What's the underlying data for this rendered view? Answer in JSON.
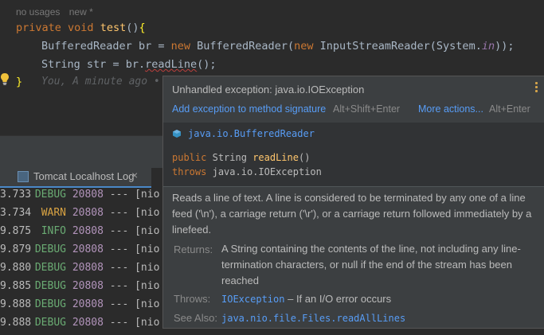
{
  "editor": {
    "meta": {
      "usages": "no usages",
      "new": "new *"
    },
    "lines": {
      "l1": {
        "kw1": "private",
        "kw2": "void",
        "name": "test",
        "parens": "()",
        "brace": "{"
      },
      "l2": {
        "type": "BufferedReader",
        "var": "br",
        "eq": "=",
        "kw": "new",
        "ctor": "BufferedReader",
        "p1": "(",
        "kw2": "new",
        "ctor2": "InputStreamReader",
        "p2": "(System.",
        "field": "in",
        "end": "));"
      },
      "l3": {
        "type": "String",
        "var": "str",
        "eq": "=",
        "call": "br.",
        "method": "readLine",
        "end": "();"
      },
      "l4": {
        "brace": "}"
      }
    },
    "inlay_hint": "You, A minute ago •"
  },
  "tool_tab": {
    "label": "Tomcat Localhost Log",
    "close": "×"
  },
  "console": {
    "rows": [
      {
        "time": "3.733",
        "level": "DEBUG",
        "level_class": "debug",
        "pid": "20808",
        "rest": "--- [nio"
      },
      {
        "time": "3.734",
        "level": "WARN",
        "level_class": "warn",
        "pid": "20808",
        "rest": "--- [nio"
      },
      {
        "time": "9.875",
        "level": "INFO",
        "level_class": "info",
        "pid": "20808",
        "rest": "--- [nio"
      },
      {
        "time": "9.879",
        "level": "DEBUG",
        "level_class": "debug",
        "pid": "20808",
        "rest": "--- [nio"
      },
      {
        "time": "9.880",
        "level": "DEBUG",
        "level_class": "debug",
        "pid": "20808",
        "rest": "--- [nio"
      },
      {
        "time": "9.885",
        "level": "DEBUG",
        "level_class": "debug",
        "pid": "20808",
        "rest": "--- [nio"
      },
      {
        "time": "9.888",
        "level": "DEBUG",
        "level_class": "debug",
        "pid": "20808",
        "rest": "--- [nio"
      },
      {
        "time": "9.888",
        "level": "DEBUG",
        "level_class": "debug",
        "pid": "20808",
        "rest": "--- [nio"
      }
    ]
  },
  "popup": {
    "title": "Unhandled exception: java.io.IOException",
    "action1": "Add exception to method signature",
    "action1_shortcut": "Alt+Shift+Enter",
    "action2": "More actions...",
    "action2_shortcut": "Alt+Enter",
    "class_name": "java.io.BufferedReader",
    "sig_kw": "public",
    "sig_type": "String",
    "sig_method": "readLine",
    "sig_parens": "()",
    "throws_kw": "throws",
    "throws_type": "java.io.IOException",
    "description": "Reads a line of text. A line is considered to be terminated by any one of a line feed ('\\n'), a carriage return ('\\r'), or a carriage return followed immediately by a linefeed.",
    "returns_label": "Returns:",
    "returns_text": "A String containing the contents of the line, not including any line-termination characters, or null if the end of the stream has been reached",
    "throws_label": "Throws:",
    "throws_link": "IOException",
    "throws_text": " – If an I/O error occurs",
    "see_label": "See Also:",
    "see_link": "java.nio.file.Files.readAllLines"
  }
}
